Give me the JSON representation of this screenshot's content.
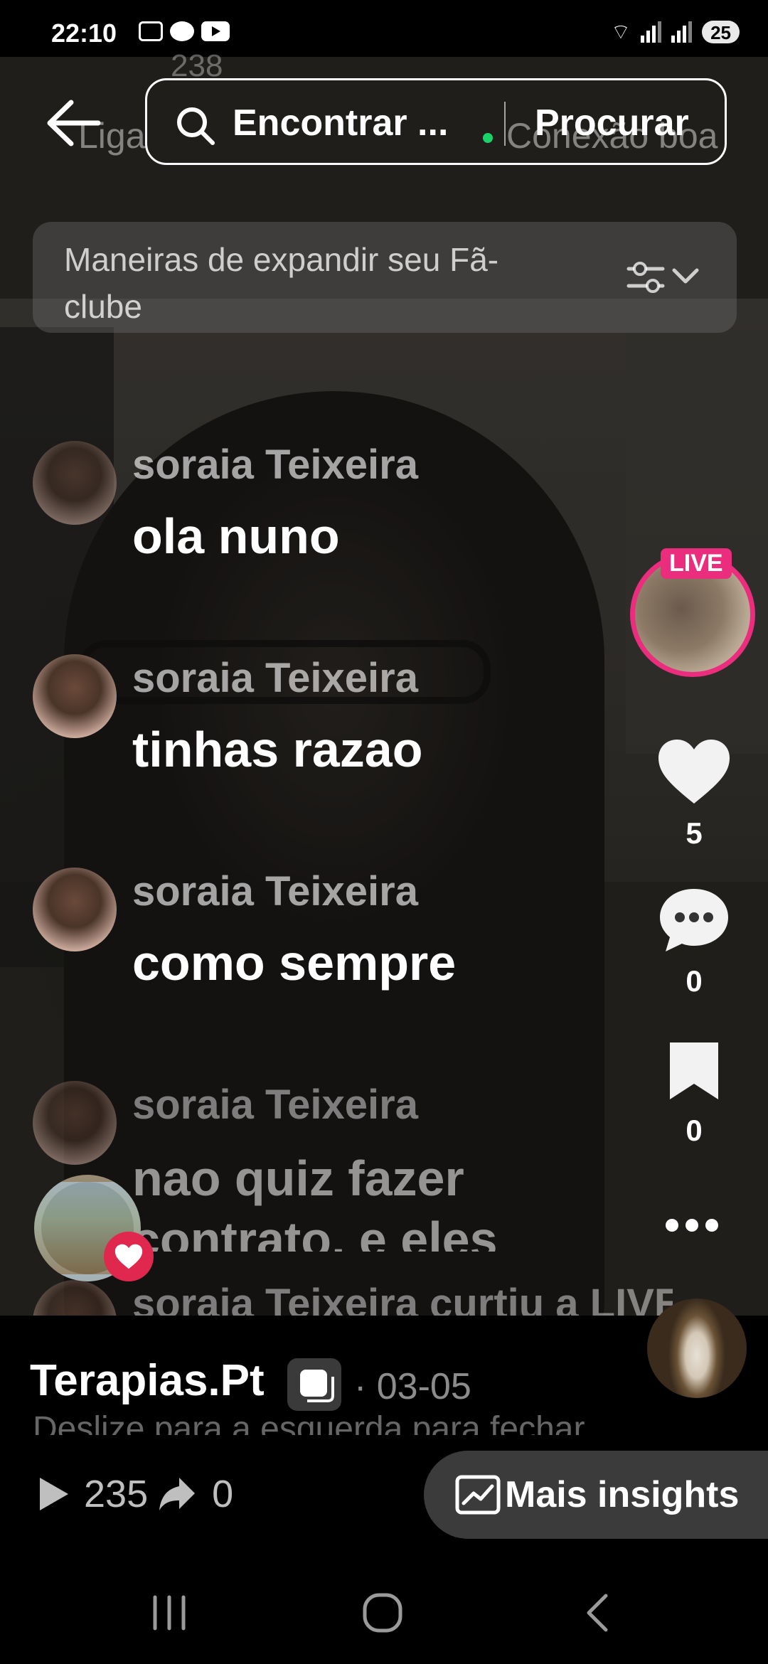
{
  "status_bar": {
    "time": "22:10",
    "battery": "25"
  },
  "header": {
    "search_text": "Encontrar ...",
    "search_button": "Procurar",
    "ghost_left": "Liga",
    "ghost_right": "Conexão boa",
    "ghost_count": "238"
  },
  "expand_card": {
    "text": "Maneiras de expandir seu Fã-clube"
  },
  "comments": [
    {
      "name": "soraia Teixeira",
      "message": "ola nuno"
    },
    {
      "name": "soraia Teixeira",
      "message": "tinhas razao"
    },
    {
      "name": "soraia Teixeira",
      "message": "como sempre"
    },
    {
      "name": "soraia Teixeira",
      "message": "nao quiz fazer contrato, e eles"
    },
    {
      "name": "soraia Teixeira curtiu a LIVE",
      "message": ""
    }
  ],
  "right_rail": {
    "live_badge": "LIVE",
    "likes": "5",
    "comments": "0",
    "saves": "0"
  },
  "footer": {
    "title": "Terapias.Pt",
    "date": "· 03-05",
    "hint": "Deslize para a esquerda para fechar",
    "plays": "235",
    "shares": "0",
    "insights_label": "Mais insights"
  }
}
